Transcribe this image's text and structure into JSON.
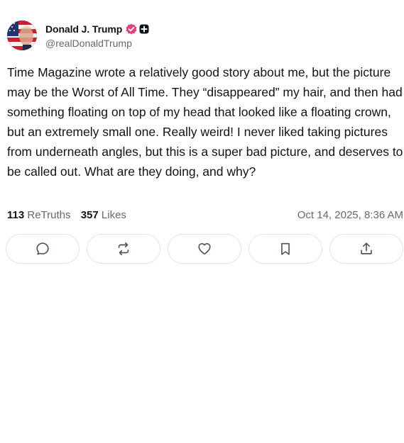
{
  "author": {
    "display_name": "Donald J. Trump",
    "handle": "@realDonaldTrump",
    "avatar_icon": "flag-portrait-avatar",
    "verified_color": "#e4407a"
  },
  "post": {
    "text": "Time Magazine wrote a relatively good story about me, but the picture may be the Worst of All Time. They “disappeared” my hair, and then had something floating on top of my head that looked like a floating crown, but an extremely small one. Really weird! I never liked taking pictures from underneath angles, but this is a super bad picture, and deserves to be called out. What are they doing, and why?"
  },
  "stats": {
    "retruths_count": "113",
    "retruths_label": "ReTruths",
    "likes_count": "357",
    "likes_label": "Likes",
    "timestamp": "Oct 14, 2025, 8:36 AM"
  },
  "actions": [
    {
      "icon": "reply-icon"
    },
    {
      "icon": "retruth-icon"
    },
    {
      "icon": "like-icon"
    },
    {
      "icon": "bookmark-icon"
    },
    {
      "icon": "share-icon"
    }
  ],
  "colors": {
    "text": "#0f1419",
    "muted": "#606a77",
    "border": "#e1e5ea"
  }
}
